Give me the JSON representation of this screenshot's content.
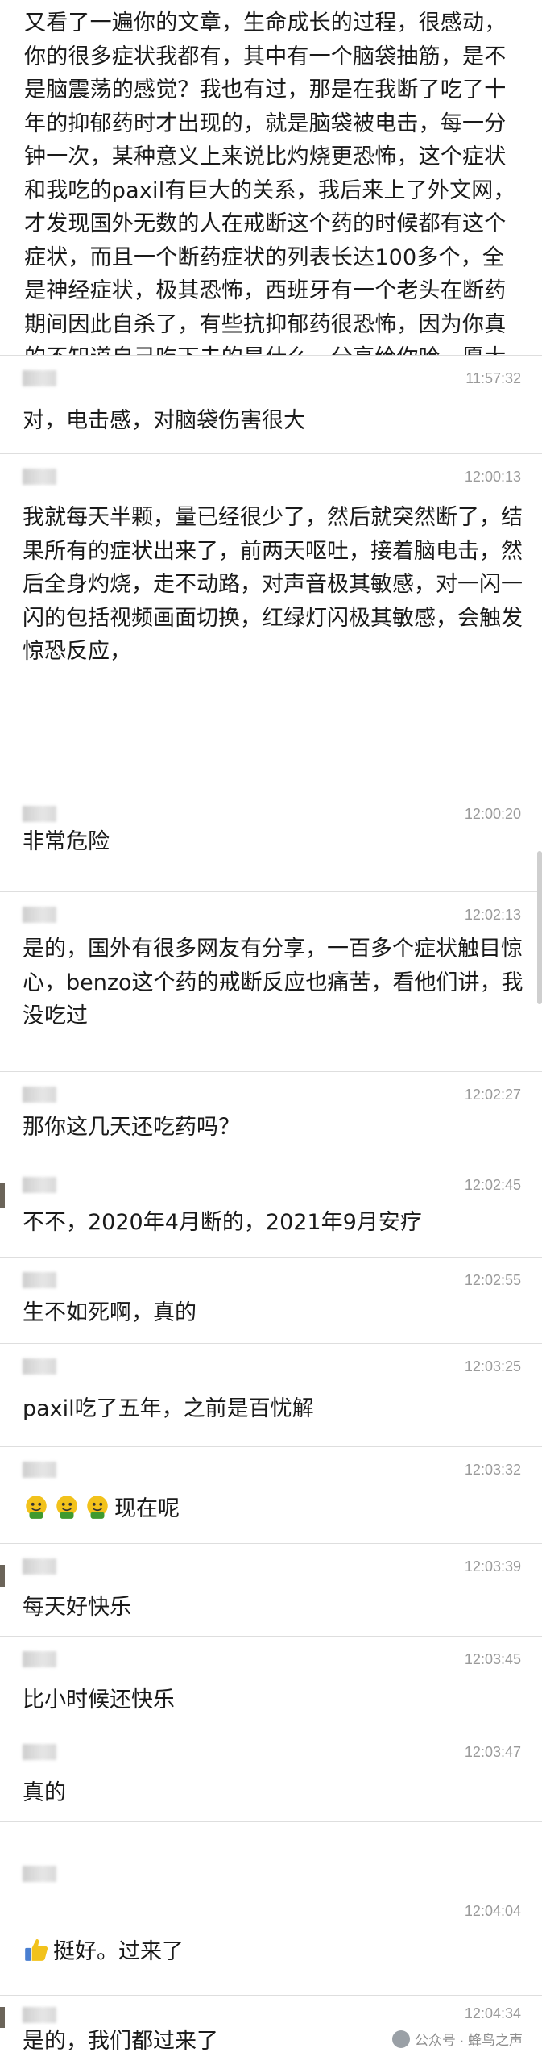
{
  "intro_text": "又看了一遍你的文章，生命成长的过程，很感动，你的很多症状我都有，其中有一个脑袋抽筋，是不是脑震荡的感觉？我也有过，那是在我断了吃了十年的抑郁药时才出现的，就是脑袋被电击，每一分钟一次，某种意义上来说比灼烧更恐怖，这个症状和我吃的paxil有巨大的关系，我后来上了外文网，才发现国外无数的人在戒断这个药的时候都有这个症状，而且一个断药症状的列表长达100多个，全是神经症状，极其恐怖，西班牙有一个老头在断药期间因此自杀了，有些抗抑郁药很恐怖，因为你真的不知道自己吃下去的是什么，分享给你哈，愿大家都好。。。。",
  "messages": [
    {
      "time": "11:57:32",
      "text": "对，电击感，对脑袋伤害很大"
    },
    {
      "time": "12:00:13",
      "text": "我就每天半颗，量已经很少了，然后就突然断了，结果所有的症状出来了，前两天呕吐，接着脑电击，然后全身灼烧，走不动路，对声音极其敏感，对一闪一闪的包括视频画面切换，红绿灯闪极其敏感，会触发惊恐反应，"
    },
    {
      "time": "12:00:20",
      "text": "非常危险"
    },
    {
      "time": "12:02:13",
      "text": "是的，国外有很多网友有分享，一百多个症状触目惊心，benzo这个药的戒断反应也痛苦，看他们讲，我没吃过"
    },
    {
      "time": "12:02:27",
      "text": "那你这几天还吃药吗？"
    },
    {
      "time": "12:02:45",
      "text": "不不，2020年4月断的，2021年9月安疗"
    },
    {
      "time": "12:02:55",
      "text": "生不如死啊，真的"
    },
    {
      "time": "12:03:25",
      "text": "paxil吃了五年，之前是百忧解"
    },
    {
      "time": "12:03:32",
      "text": "现在呢",
      "emoji": [
        "emoji-1",
        "emoji-2",
        "emoji-3"
      ]
    },
    {
      "time": "12:03:39",
      "text": "每天好快乐"
    },
    {
      "time": "12:03:45",
      "text": "比小时候还快乐"
    },
    {
      "time": "12:03:47",
      "text": "真的"
    },
    {
      "time": "12:04:04",
      "text": "挺好。过来了",
      "emoji": [
        "thumbs-up"
      ]
    },
    {
      "time": "12:04:34",
      "text": "是的，我们都过来了"
    }
  ],
  "watermark": "公众号 · 蜂鸟之声",
  "colors": {
    "background": "#f3f3f3",
    "card": "#ffffff",
    "timestamp": "#9a9a9a"
  }
}
